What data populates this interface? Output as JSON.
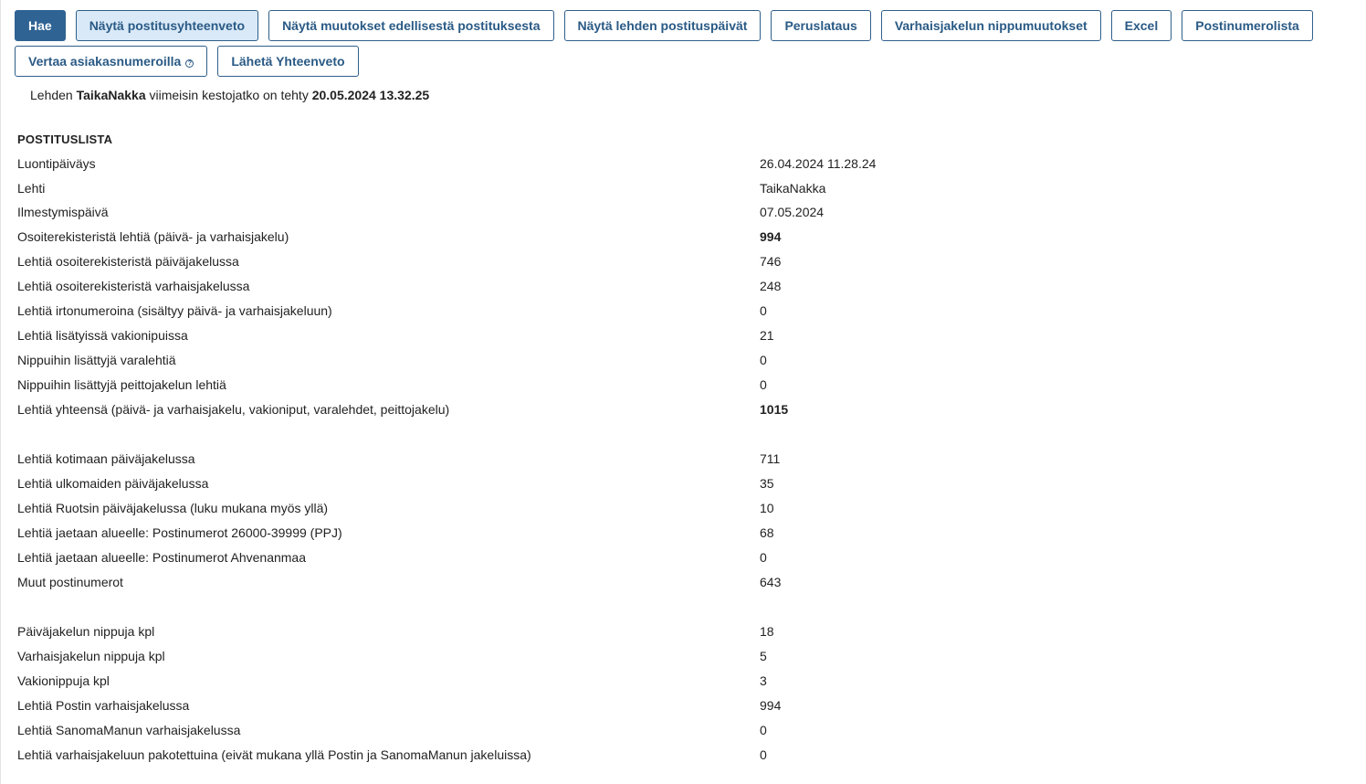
{
  "toolbar": {
    "buttons": [
      {
        "label": "Hae"
      },
      {
        "label": "Näytä postitusyhteenveto"
      },
      {
        "label": "Näytä muutokset edellisestä postituksesta"
      },
      {
        "label": "Näytä lehden postituspäivät"
      },
      {
        "label": "Peruslataus"
      },
      {
        "label": "Varhaisjakelun nippumuutokset"
      },
      {
        "label": "Excel"
      },
      {
        "label": "Postinumerolista"
      },
      {
        "label": "Vertaa asiakasnumeroilla"
      },
      {
        "label": "Lähetä Yhteenveto"
      }
    ],
    "help_icon": "question-circle-icon"
  },
  "status": {
    "prefix": "Lehden",
    "paper": "TaikaNakka",
    "middle": "viimeisin kestojatko on tehty",
    "timestamp": "20.05.2024 13.32.25"
  },
  "section": {
    "title": "POSTITUSLISTA"
  },
  "rows": [
    {
      "label": "Luontipäiväys",
      "value": "26.04.2024 11.28.24"
    },
    {
      "label": "Lehti",
      "value": "TaikaNakka"
    },
    {
      "label": "Ilmestymispäivä",
      "value": "07.05.2024"
    },
    {
      "label": "Osoiterekisteristä lehtiä (päivä- ja varhaisjakelu)",
      "value": "994"
    },
    {
      "label": "Lehtiä osoiterekisteristä päiväjakelussa",
      "value": "746"
    },
    {
      "label": "Lehtiä osoiterekisteristä varhaisjakelussa",
      "value": "248"
    },
    {
      "label": "Lehtiä irtonumeroina (sisältyy päivä- ja varhaisjakeluun)",
      "value": "0"
    },
    {
      "label": "Lehtiä lisätyissä vakionipuissa",
      "value": "21"
    },
    {
      "label": "Nippuihin lisättyjä varalehtiä",
      "value": "0"
    },
    {
      "label": "Nippuihin lisättyjä peittojakelun lehtiä",
      "value": "0"
    },
    {
      "label": "Lehtiä yhteensä (päivä- ja varhaisjakelu, vakioniput, varalehdet, peittojakelu)",
      "value": "1015"
    },
    {
      "label": "Lehtiä kotimaan päiväjakelussa",
      "value": "711"
    },
    {
      "label": "Lehtiä ulkomaiden päiväjakelussa",
      "value": "35"
    },
    {
      "label": "Lehtiä Ruotsin päiväjakelussa (luku mukana myös yllä)",
      "value": "10"
    },
    {
      "label": "Lehtiä jaetaan alueelle: Postinumerot 26000-39999 (PPJ)",
      "value": "68"
    },
    {
      "label": "Lehtiä jaetaan alueelle: Postinumerot Ahvenanmaa",
      "value": "0"
    },
    {
      "label": "Muut postinumerot",
      "value": "643"
    },
    {
      "label": "Päiväjakelun nippuja kpl",
      "value": "18"
    },
    {
      "label": "Varhaisjakelun nippuja kpl",
      "value": "5"
    },
    {
      "label": "Vakionippuja kpl",
      "value": "3"
    },
    {
      "label": "Lehtiä Postin varhaisjakelussa",
      "value": "994"
    },
    {
      "label": "Lehtiä SanomaManun varhaisjakelussa",
      "value": "0"
    },
    {
      "label": "Lehtiä varhaisjakeluun pakotettuina (eivät mukana yllä Postin ja SanomaManun jakeluissa)",
      "value": "0"
    }
  ]
}
